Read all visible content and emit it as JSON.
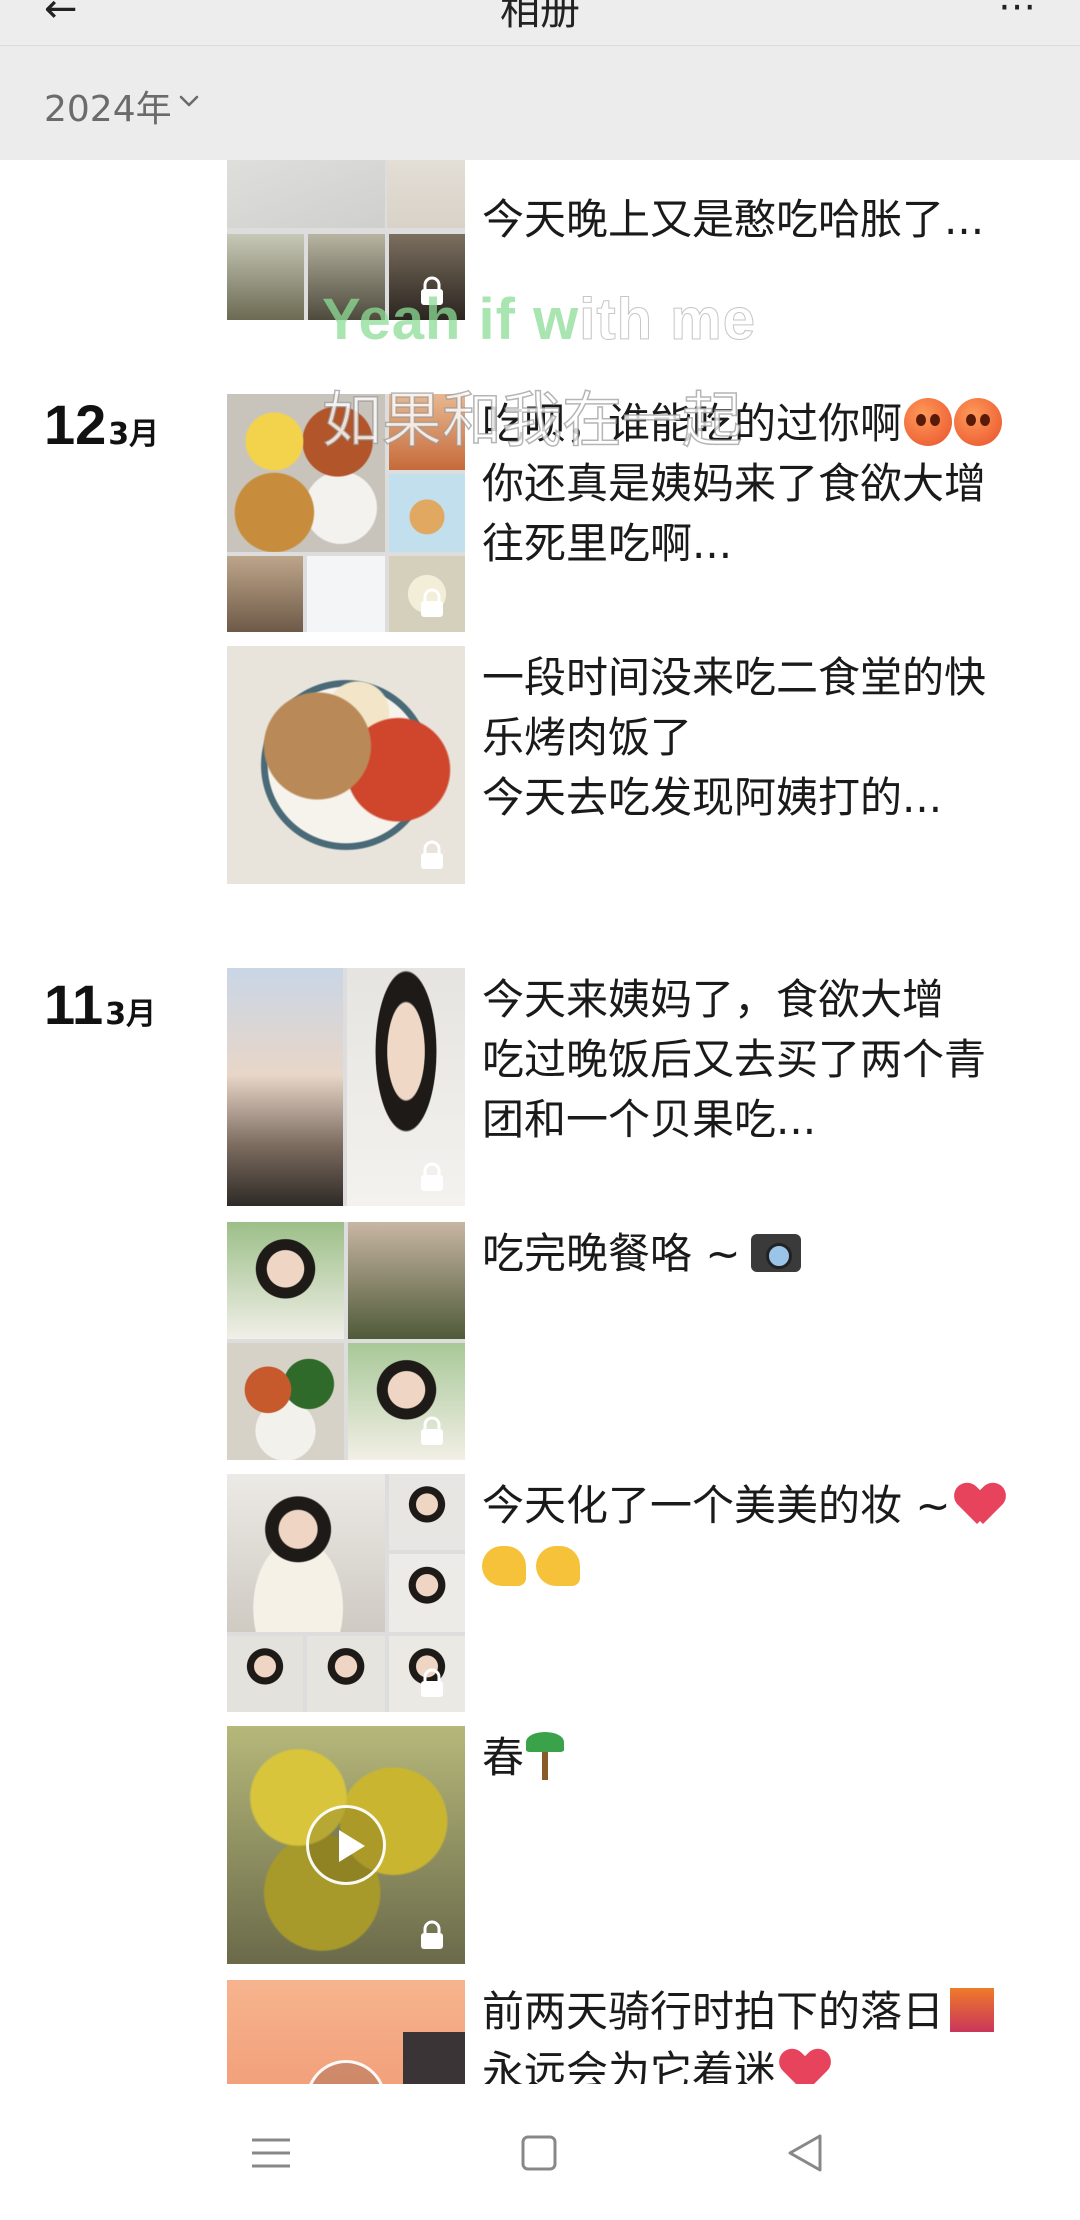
{
  "header": {
    "back_glyph": "←",
    "title": "相册",
    "action_glyph": "⋯"
  },
  "year_filter": {
    "label": "2024年",
    "icon": "chevron-down-icon"
  },
  "lyrics": {
    "line1_highlight": "Yeah if w",
    "line1_rest": "ith me",
    "line2": "如果和我在一起"
  },
  "timeline": {
    "partial_post": {
      "title_fragment": "",
      "text": "今天晚上又是憨吃哈胀了..."
    },
    "days": [
      {
        "day": "12",
        "month": "3月",
        "posts": [
          {
            "line1": "吃呗，谁能吃的过你啊",
            "line2": "你还真是姨妈来了食欲大增",
            "line3": "往死里吃啊..."
          },
          {
            "line1": "一段时间没来吃二食堂的快",
            "line2": "乐烤肉饭了",
            "line3": "今天去吃发现阿姨打的..."
          }
        ]
      },
      {
        "day": "11",
        "month": "3月",
        "posts": [
          {
            "line1": "今天来姨妈了，食欲大增",
            "line2": "吃过晚饭后又去买了两个青",
            "line3": "团和一个贝果吃..."
          },
          {
            "line1": "吃完晚餐咯 ~"
          },
          {
            "line1": "今天化了一个美美的妆 ~"
          },
          {
            "line1": "春"
          },
          {
            "line1": "前两天骑行时拍下的落日",
            "line2": "永远会为它着迷"
          }
        ]
      }
    ]
  },
  "colors": {
    "accent_lyric": "#8cdc96",
    "topbar_bg": "#ededed",
    "heart": "#e8435c"
  }
}
